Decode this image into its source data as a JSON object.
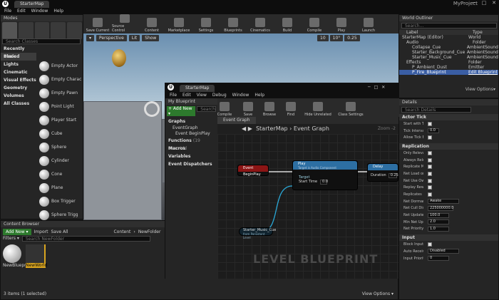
{
  "app": {
    "tab": "StarterMap",
    "project": "MyProject",
    "window_buttons": [
      "─",
      "□",
      "✕"
    ]
  },
  "menu": [
    "File",
    "Edit",
    "Window",
    "Help"
  ],
  "modes": {
    "title": "Modes",
    "search_placeholder": "Search Classes",
    "categories": [
      "Recently Placed",
      "Basic",
      "Lights",
      "Cinematic",
      "Visual Effects",
      "Geometry",
      "Volumes",
      "All Classes"
    ],
    "items": [
      "Empty Actor",
      "Empty Charac",
      "Empty Pawn",
      "Point Light",
      "Player Start",
      "Cube",
      "Sphere",
      "Cylinder",
      "Cone",
      "Plane",
      "Box Trigger",
      "Sphere Trigg"
    ]
  },
  "toolbar": [
    "Save Current",
    "Source Control",
    "Content",
    "Marketplace",
    "Settings",
    "Blueprints",
    "Cinematics",
    "Build",
    "Compile",
    "Play",
    "Launch"
  ],
  "viewport": {
    "buttons": [
      "Perspective",
      "Lit",
      "Show"
    ],
    "snap": [
      "10",
      "10°",
      "0.25"
    ]
  },
  "outliner": {
    "title": "World Outliner",
    "search_placeholder": "Search...",
    "col_label": "Label",
    "col_type": "Type",
    "rows": [
      {
        "label": "StarterMap (Editor)",
        "type": "World"
      },
      {
        "label": "Audio",
        "type": "Folder"
      },
      {
        "label": "Collapse_Cue",
        "type": "AmbientSound"
      },
      {
        "label": "Starter_Background_Cue",
        "type": "AmbientSound"
      },
      {
        "label": "Starter_Music_Cue",
        "type": "AmbientSound"
      },
      {
        "label": "Effects",
        "type": "Folder"
      },
      {
        "label": "P_Ambient_Dust",
        "type": "Emitter"
      },
      {
        "label": "P_Fire_Blueprint",
        "type": "Edit Blueprint"
      }
    ],
    "view_options": "View Options▾"
  },
  "details": {
    "title": "Details",
    "search_placeholder": "Search Details",
    "actor_tick": "Actor Tick",
    "start_with_tick": "Start with Tic",
    "tick_interval": "Tick Interval",
    "tick_interval_value": "0.0",
    "allow_tick": "Allow Tick Be",
    "replication": "Replication",
    "rep_rows": [
      "Only Relevan",
      "Always Relev",
      "Replicate Mo",
      "Net Load on C",
      "Net Use Own",
      "Replay Rewin",
      "Replicates"
    ],
    "net_dormancy": "Net Dormanc",
    "net_dormancy_value": "Awake",
    "net_cull": "Net Cull Dist",
    "net_cull_value": "225000000.0",
    "net_update": "Net Update F",
    "net_update_value": "100.0",
    "min_net": "Min Net Upd",
    "min_net_value": "2.0",
    "net_priority": "Net Priority",
    "net_priority_value": "1.0",
    "input": "Input",
    "block_input": "Block Input",
    "auto_receive": "Auto Receive",
    "auto_receive_value": "Disabled",
    "input_priority": "Input Priority",
    "input_priority_value": "0"
  },
  "content_browser": {
    "title": "Content Browser",
    "add_new": "Add New ▾",
    "import": "Import",
    "save_all": "Save All",
    "crumbs": [
      "Content",
      "NewFolder"
    ],
    "filters": "Filters ▾",
    "search_placeholder": "Search NewFolder",
    "assets": [
      "NewBlueprint",
      "NewWorld"
    ],
    "status": "3 items (1 selected)",
    "view_options": "View Options ▾"
  },
  "blueprint": {
    "tab": "StarterMap",
    "menu": [
      "File",
      "Edit",
      "View",
      "Debug",
      "Window",
      "Help"
    ],
    "toolbar": [
      "Compile",
      "Save",
      "Browse",
      "Find",
      "Hide Unrelated",
      "Class Settings"
    ],
    "my_blueprint": "My Blueprint",
    "add_new": "+ Add New ▾",
    "search_placeholder": "Search",
    "graphs": "Graphs",
    "event_graph": "EventGraph",
    "event_beginplay": "Event BeginPlay",
    "functions": "Functions",
    "functions_count": "(19 Overridd",
    "macros": "Macros",
    "variables": "Variables",
    "dispatchers": "Event Dispatchers",
    "graph_tab": "Event Graph",
    "crumbs": [
      "StarterMap",
      "Event Graph"
    ],
    "zoom": "Zoom -2",
    "node_begin": "Event BeginPlay",
    "node_play": "Play",
    "node_play_sub": "Target is Audio Component",
    "play_target": "Target",
    "play_start": "Start Time",
    "play_start_value": "0.0",
    "node_delay": "Delay",
    "delay_duration": "Duration",
    "delay_value": "0.25",
    "node_var": "Starter_Music_Cue",
    "node_var_sub": "from Persistent Level",
    "watermark": "LEVEL BLUEPRINT"
  }
}
